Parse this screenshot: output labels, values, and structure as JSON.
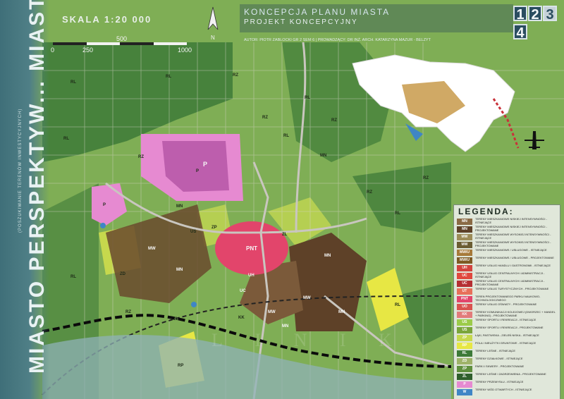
{
  "project": {
    "vertical_title": "MIASTO PERSPEKTYW... MIASTECZKO ŚLĄSKIE",
    "vertical_sub": "MIASTO PERSPEKTYW...",
    "vertical_sub2": "(POSZUKIWANIE TERENÓW INWESTYCYJNYCH)",
    "title": "KONCEPCJA PLANU MIASTA",
    "subtitle": "PROJEKT KONCEPCYJNY",
    "authors": "AUTOR: PIOTR ZABLOCKI  GR 2 SEM 6  |  PROWADZĄCY: DR INŻ. ARCH. KATARZYNA MAZUR - BELZYT"
  },
  "scale": {
    "label": "SKALA 1:20 000",
    "ticks_top": [
      "500"
    ],
    "ticks_bottom": [
      "0",
      "250",
      "1000"
    ]
  },
  "nav": [
    {
      "label": "1",
      "active": false
    },
    {
      "label": "2",
      "active": false
    },
    {
      "label": "3",
      "active": true
    },
    {
      "label": "4",
      "active": false
    }
  ],
  "map_labels": {
    "industrial": "P",
    "center": "PNT",
    "locality": "L I N  I  K",
    "forest": "RL",
    "agri": "RZ"
  },
  "zone_labels": [
    "RL",
    "RL",
    "RZ",
    "RL",
    "RZ",
    "RZ",
    "RL",
    "RL",
    "RZ",
    "MN",
    "RZ",
    "RL",
    "RZ",
    "RL",
    "MN",
    "P",
    "P",
    "MW",
    "MN",
    "ZP",
    "US",
    "MW",
    "UH",
    "MN",
    "ZD",
    "ZL",
    "ZL",
    "MN",
    "UC",
    "RZ",
    "RP",
    "MW",
    "MN",
    "KK",
    "RL"
  ],
  "colors": {
    "forest": "#3d7a38",
    "agri": "#7fae55",
    "industrial": "#e68ad1",
    "residential_low": "#6a4a2e",
    "service_center": "#e2456b",
    "green": "#c6d84d",
    "sport": "#8fb43b",
    "open_land": "#e7e744",
    "water": "#3f86c6",
    "road": "#c9c6bf",
    "border": "#0b0b0b"
  },
  "legend": {
    "title": "LEGENDA:",
    "items": [
      {
        "code": "MN",
        "color": "#8a6a45",
        "text": "TERENY MIESZKANIOWE NISKIEJ INTENSYWNOŚCI - ISTNIEJĄCE"
      },
      {
        "code": "MN",
        "color": "#5e4128",
        "text": "TERENY MIESZKANIOWE NISKIEJ INTENSYWNOŚCI - PROJEKTOWANE"
      },
      {
        "code": "MW",
        "color": "#9c8b57",
        "text": "TERENY MIESZKANIOWE WYSOKIEJ INTENSYWNOŚCI - ISTNIEJĄCE"
      },
      {
        "code": "MW",
        "color": "#6b5d33",
        "text": "TERENY MIESZKANIOWE WYSOKIEJ INTENSYWNOŚCI - PROJEKTOWANE"
      },
      {
        "code": "MW/U",
        "color": "#a77a3a",
        "text": "TERENY MIESZKANIOWE / USŁUGOWE - ISTNIEJĄCE"
      },
      {
        "code": "MW/U",
        "color": "#7d5a24",
        "text": "TERENY MIESZKANIOWE / USŁUGOWE - PROJEKTOWANE"
      },
      {
        "code": "UH",
        "color": "#d2433e",
        "text": "TERENY USŁUG HANDLU I GASTRONOMII - ISTNIEJĄCE"
      },
      {
        "code": "UC",
        "color": "#e0483e",
        "text": "TERENY USŁUG CENTRALNYCH I ADMINISTRACJI - ISTNIEJĄCE"
      },
      {
        "code": "UC",
        "color": "#b52f33",
        "text": "TERENY USŁUG CENTRALNYCH I ADMINISTRACJI - PROJEKTOWANE"
      },
      {
        "code": "UT",
        "color": "#e8705a",
        "text": "TERENY USŁUG TURYSTYCZNYCH - PROJEKTOWANE"
      },
      {
        "code": "PNT",
        "color": "#e2456b",
        "text": "TEREN PROJEKTOWANEGO PARKU NAUKOWO-TECHNOLOGICZNEGO"
      },
      {
        "code": "UO",
        "color": "#d9534f",
        "text": "TERENY USŁUG OŚWIATY - PROJEKTOWANE"
      },
      {
        "code": "KK",
        "color": "#e27b7b",
        "text": "TERENY KOMUNIKACJI KOLEJOWEJ (DWORZEC + HANDEL + PARKING) - PROJEKTOWANE"
      },
      {
        "code": "US",
        "color": "#9ccb4a",
        "text": "TERENY SPORTU I REKREACJI - ISTNIEJĄCE"
      },
      {
        "code": "US",
        "color": "#7aa53a",
        "text": "TERENY SPORTU I REKREACJI - PROJEKTOWANE"
      },
      {
        "code": "ZP",
        "color": "#c6d84d",
        "text": "ŁĄKI, PASTWISKA - ZIELEŃ NISKA - ISTNIEJĄCE"
      },
      {
        "code": "RP",
        "color": "#e7e744",
        "text": "POLA I NIEUŻYTKI GRUNTOWE - ISTNIEJĄCE"
      },
      {
        "code": "RL",
        "color": "#3d7a38",
        "text": "TERENY LEŚNE - ISTNIEJĄCE"
      },
      {
        "code": "ZD",
        "color": "#9fb36a",
        "text": "TERENY DZIAŁKOWE - ISTNIEJĄCE"
      },
      {
        "code": "ZP",
        "color": "#5f8f3e",
        "text": "PARKI I SKWERY - PROJEKTOWANE"
      },
      {
        "code": "ZL",
        "color": "#2f5f2c",
        "text": "TERENY LEŚNE I ZADRZEWIENIA - PROJEKTOWANE"
      },
      {
        "code": "P",
        "color": "#e68ad1",
        "text": "TERENY PRZEMYSŁU - ISTNIEJĄCE"
      },
      {
        "code": "W",
        "color": "#3f86c6",
        "text": "TERENY WÓD OTWARTYCH - ISTNIEJĄCE"
      }
    ]
  }
}
